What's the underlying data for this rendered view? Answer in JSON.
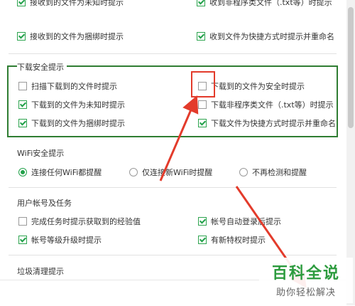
{
  "top_section": {
    "row1_left": "接收到的文件为未知时提示",
    "row1_right": "收到非程序类文件（.txt等）时提示",
    "row2_left": "接收到的文件为捆绑时提示",
    "row2_right": "收到文件为快捷方式时提示并重命名"
  },
  "download": {
    "title": "下载安全提示",
    "options": [
      {
        "label": "扫描下载到的文件时提示",
        "checked": false
      },
      {
        "label": "下载到的文件为安全时提示",
        "checked": false
      },
      {
        "label": "下载到的文件为未知时提示",
        "checked": true
      },
      {
        "label": "下载非程序类文件（.txt等）时提示",
        "checked": false
      },
      {
        "label": "下载到的文件为捆绑时提示",
        "checked": true
      },
      {
        "label": "下载文件为快捷方式时提示并重命名",
        "checked": true
      }
    ]
  },
  "wifi": {
    "title": "WiFi安全提示",
    "options": [
      {
        "label": "连接任何WiFi都提醒",
        "checked": true
      },
      {
        "label": "仅连接新WiFi时提醒",
        "checked": false
      },
      {
        "label": "不再检测和提醒",
        "checked": false
      }
    ]
  },
  "account": {
    "title": "用户帐号及任务",
    "options": [
      {
        "label": "完成任务时提示获取到的经验值",
        "checked": false
      },
      {
        "label": "帐号自动登录后提示",
        "checked": true
      },
      {
        "label": "帐号等级升级时提示",
        "checked": true
      },
      {
        "label": "有新特权时提示",
        "checked": true
      }
    ]
  },
  "cleanup": {
    "title": "垃圾清理提示"
  },
  "watermark": {
    "top": "百科全说",
    "bottom": "助你轻松解决"
  },
  "colors": {
    "green_highlight": "#2f7d32",
    "red_highlight": "#e33b2b",
    "check_green": "#22a14a"
  }
}
